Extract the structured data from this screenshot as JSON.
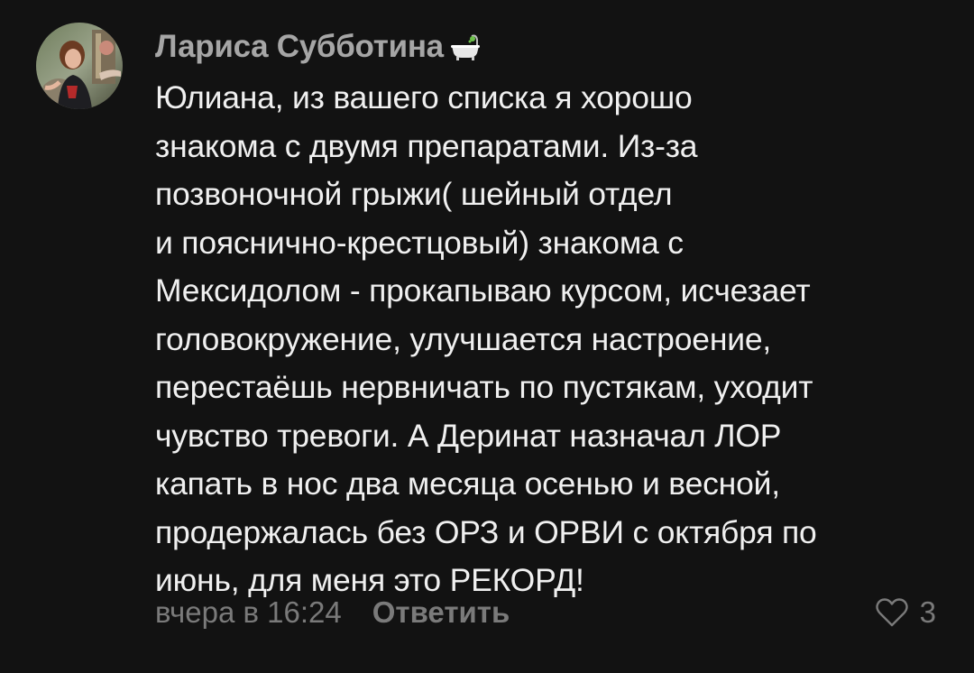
{
  "comment": {
    "author": {
      "name": "Лариса Субботина",
      "badge_icon": "bathtub-icon",
      "avatar_icon": "avatar-photo"
    },
    "text_lines": [
      "Юлиана, из вашего списка я хорошо",
      "знакома с двумя препаратами. Из-за",
      "позвоночной грыжи( шейный отдел",
      "и пояснично-крестцовый) знакома с",
      "Мексидолом - прокапываю курсом, исчезает",
      "головокружение, улучшается настроение,",
      "перестаёшь нервничать по пустякам, уходит",
      "чувство тревоги. А Деринат назначал ЛОР",
      "капать в нос два месяца осенью и весной,",
      "продержалась без ОРЗ и ОРВИ с октября по",
      "июнь, для меня это РЕКОРД!"
    ],
    "footer": {
      "timestamp": "вчера в 16:24",
      "reply_label": "Ответить",
      "like_icon": "heart-outline-icon",
      "like_count": "3"
    }
  },
  "colors": {
    "background": "#121212",
    "text": "#f0f0f0",
    "author": "#a6a6a6",
    "muted": "#7a7a7a"
  }
}
